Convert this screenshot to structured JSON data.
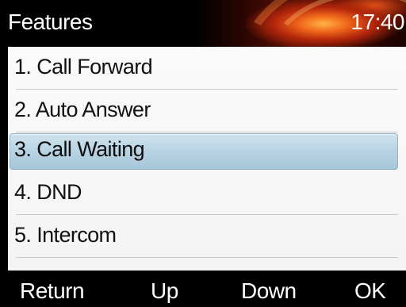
{
  "header": {
    "title": "Features",
    "time": "17:40"
  },
  "menu": {
    "items": [
      {
        "label": "1. Call Forward",
        "selected": false
      },
      {
        "label": "2. Auto Answer",
        "selected": false
      },
      {
        "label": "3. Call Waiting",
        "selected": true
      },
      {
        "label": "4. DND",
        "selected": false
      },
      {
        "label": "5. Intercom",
        "selected": false
      }
    ]
  },
  "softkeys": {
    "return_label": "Return",
    "up_label": "Up",
    "down_label": "Down",
    "ok_label": "OK"
  },
  "colors": {
    "highlight": "#b7d3e3",
    "menu_background": "#f6f6f6",
    "header_accent": "#f0661a"
  }
}
